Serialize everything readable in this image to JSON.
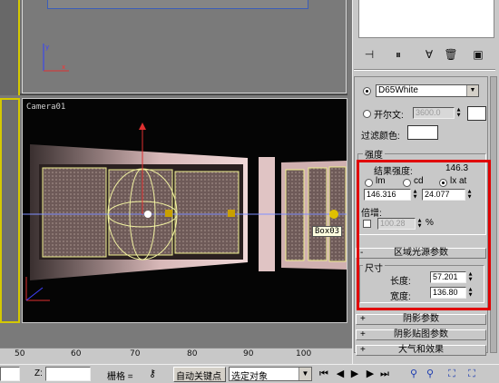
{
  "viewport_top": {
    "label": ""
  },
  "viewport_camera": {
    "label": "Camera01",
    "object_tooltip": "Box03"
  },
  "ruler": {
    "ticks": [
      "50",
      "60",
      "70",
      "80",
      "90",
      "100"
    ]
  },
  "statusbar": {
    "z_label": "Z:",
    "z_value": "",
    "grid_label": "栅格 =",
    "auto_key_button": "自动关键点",
    "selection_dropdown": "选定对象"
  },
  "command_panel": {
    "tool_icons": [
      "pin-icon",
      "pause-bar-icon",
      "modifier-icon",
      "delete-icon",
      "configure-icon"
    ],
    "color_preset": "D65White",
    "kelvin_label": "开尔文:",
    "kelvin_value": "3600.0",
    "filter_color_label": "过滤颜色:",
    "filter_color": "#ffffff",
    "intensity_group_title": "强度",
    "result_intensity_label": "结果强度:",
    "result_intensity_value": "146.3",
    "units": [
      "lm",
      "cd",
      "lx at"
    ],
    "selected_unit": "lx at",
    "intensity_value": "146.316",
    "distance_value": "24.077",
    "multiplier_group_title": "倍增:",
    "multiplier_value": "100.28",
    "percent_sign": "%",
    "area_light_rollout": "区域光源参数",
    "size_group_title": "尺寸",
    "length_label": "长度:",
    "length_value": "57.201",
    "width_label": "宽度:",
    "width_value": "136.80",
    "shadow_params_rollout": "阴影参数",
    "shadow_map_rollout": "阴影贴图参数",
    "atmosphere_rollout": "大气和效果"
  }
}
